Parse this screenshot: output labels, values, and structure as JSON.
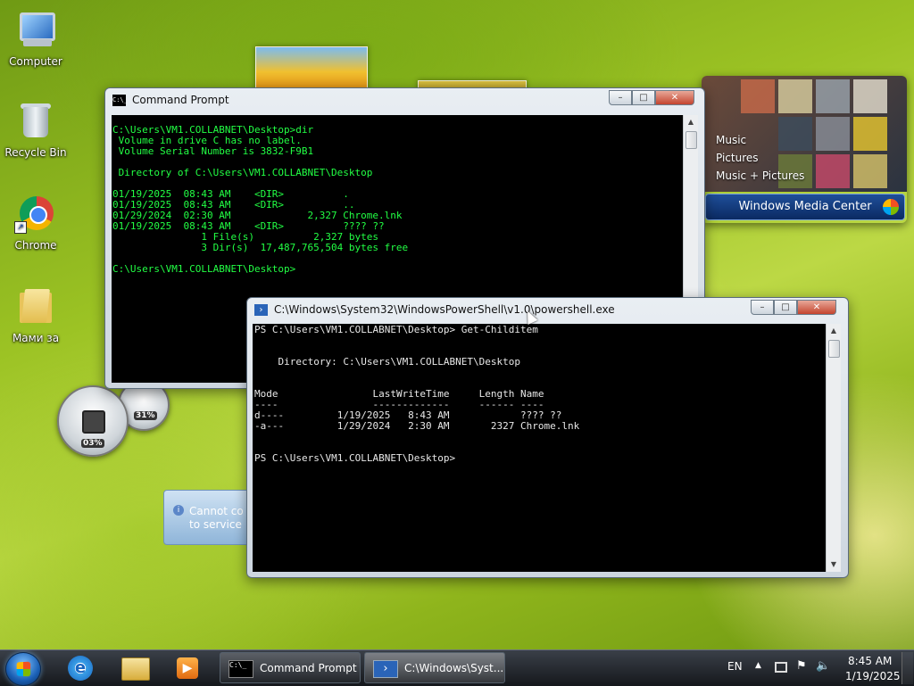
{
  "desktop": {
    "icons": [
      {
        "label": "Computer"
      },
      {
        "label": "Recycle Bin"
      },
      {
        "label": "Chrome"
      },
      {
        "label": "Мами за"
      }
    ]
  },
  "cmd_window": {
    "title": "Command Prompt",
    "icon_text": "C:\\_",
    "lines": [
      "C:\\Users\\VM1.COLLABNET\\Desktop>dir",
      " Volume in drive C has no label.",
      " Volume Serial Number is 3832-F9B1",
      "",
      " Directory of C:\\Users\\VM1.COLLABNET\\Desktop",
      "",
      "01/19/2025  08:43 AM    <DIR>          .",
      "01/19/2025  08:43 AM    <DIR>          ..",
      "01/29/2024  02:30 AM             2,327 Chrome.lnk",
      "01/19/2025  08:43 AM    <DIR>          ???? ??",
      "               1 File(s)          2,327 bytes",
      "               3 Dir(s)  17,487,765,504 bytes free",
      "",
      "C:\\Users\\VM1.COLLABNET\\Desktop>"
    ],
    "text_color": "#22ff44"
  },
  "ps_window": {
    "title": "C:\\Windows\\System32\\WindowsPowerShell\\v1.0\\powershell.exe",
    "lines": [
      "PS C:\\Users\\VM1.COLLABNET\\Desktop> Get-Childitem",
      "",
      "",
      "    Directory: C:\\Users\\VM1.COLLABNET\\Desktop",
      "",
      "",
      "Mode                LastWriteTime     Length Name",
      "----                -------------     ------ ----",
      "d----         1/19/2025   8:43 AM            ???? ??",
      "-a---         1/29/2024   2:30 AM       2327 Chrome.lnk",
      "",
      "",
      "PS C:\\Users\\VM1.COLLABNET\\Desktop>"
    ],
    "text_color": "#e8e8e8"
  },
  "caption_buttons": {
    "minimize": "–",
    "maximize": "□",
    "close": "✕"
  },
  "media_center": {
    "menu": [
      "Music",
      "Pictures",
      "Music + Pictures"
    ],
    "brand": "Windows Media Center"
  },
  "gauges": {
    "cpu": "03%",
    "memory": "31%"
  },
  "notification": {
    "text_line1": "Cannot co",
    "text_line2": "to service"
  },
  "taskbar": {
    "buttons": [
      {
        "label": "Command Prompt"
      },
      {
        "label": "C:\\Windows\\Syst..."
      }
    ],
    "language": "EN",
    "time": "8:45 AM",
    "date": "1/19/2025"
  },
  "colors": {
    "accent": "#1a5fb4",
    "cmd_green": "#22ff44"
  }
}
